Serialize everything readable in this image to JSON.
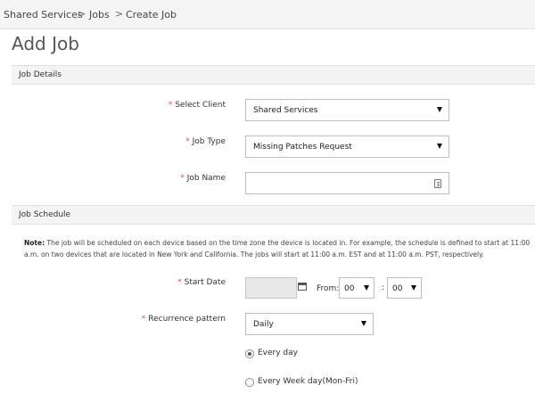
{
  "breadcrumb": {
    "items": [
      "Shared Services",
      "Jobs",
      "Create Job"
    ],
    "separator": ">"
  },
  "page": {
    "title": "Add Job"
  },
  "sections": {
    "job_details": "Job Details",
    "job_schedule": "Job Schedule"
  },
  "required_marker": "*",
  "job_details": {
    "select_client": {
      "label": "Select Client",
      "value": "Shared Services"
    },
    "job_type": {
      "label": "Job Type",
      "value": "Missing Patches Request"
    },
    "job_name": {
      "label": "Job Name",
      "value": ""
    }
  },
  "schedule": {
    "note_prefix": "Note:",
    "note_text": "The job will be scheduled on each device based on the time zone the device is located in. For example, the schedule is defined to start at 11:00 a.m. on two devices that are located in New York and California. The jobs will start at 11:00 a.m. EST and at 11:00 a.m. PST, respectively.",
    "start_date": {
      "label": "Start Date",
      "value": ""
    },
    "from_label": "From:",
    "hour": "00",
    "minute": "00",
    "time_separator": ":",
    "recurrence": {
      "label": "Recurrence pattern",
      "value": "Daily"
    },
    "options": [
      {
        "label": "Every day",
        "checked": true
      },
      {
        "label": "Every Week day(Mon-Fri)",
        "checked": false
      }
    ]
  },
  "colors": {
    "required": "#d9534f",
    "section_bg": "#f4f4f4",
    "topbar_bg": "#f5f5f5",
    "date_input_bg": "#e8e8e8"
  }
}
